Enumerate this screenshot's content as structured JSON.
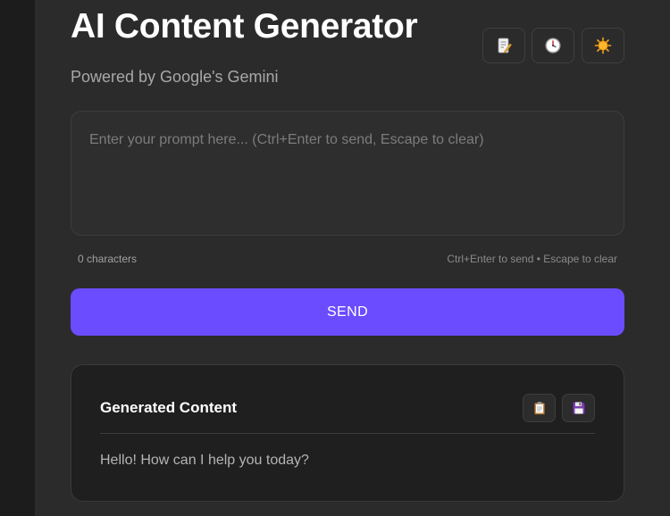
{
  "header": {
    "title": "AI Content Generator",
    "subtitle": "Powered by Google's Gemini",
    "icons": [
      "notepad-icon",
      "history-clock-icon",
      "theme-sun-icon"
    ]
  },
  "prompt": {
    "value": "",
    "placeholder": "Enter your prompt here... (Ctrl+Enter to send, Escape to clear)",
    "char_count": "0 characters",
    "shortcut_hint": "Ctrl+Enter to send • Escape to clear"
  },
  "send_button": {
    "label": "SEND"
  },
  "output": {
    "title": "Generated Content",
    "text": "Hello! How can I help you today?",
    "icons": [
      "clipboard-copy-icon",
      "save-floppy-icon"
    ]
  },
  "colors": {
    "accent": "#6b4cff",
    "panel": "#2b2b2b",
    "card": "#1f1f1f"
  }
}
